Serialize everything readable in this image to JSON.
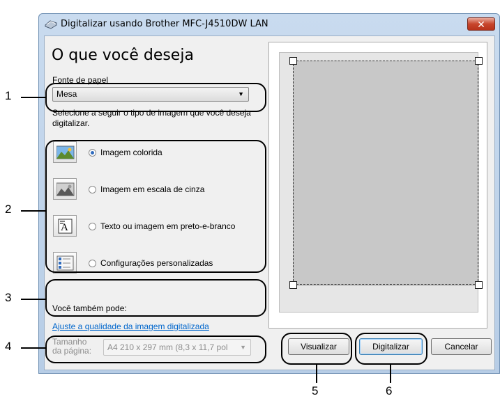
{
  "window": {
    "title": "Digitalizar usando Brother MFC-J4510DW LAN",
    "close_label": "✕"
  },
  "main": {
    "heading": "O que você deseja",
    "paper_source_label": "Fonte de papel",
    "paper_source_value": "Mesa",
    "instruction": "Selecione a seguir o tipo de imagem que você deseja digitalizar.",
    "image_types": [
      {
        "label": "Imagem colorida",
        "selected": true,
        "icon": "color-photo-icon"
      },
      {
        "label": "Imagem em escala de cinza",
        "selected": false,
        "icon": "grayscale-photo-icon"
      },
      {
        "label": "Texto ou imagem em preto-e-branco",
        "selected": false,
        "icon": "bw-text-icon"
      },
      {
        "label": "Configurações personalizadas",
        "selected": false,
        "icon": "custom-settings-icon"
      }
    ],
    "also_label": "Você também pode:",
    "adjust_link": "Ajuste a qualidade da imagem digitalizada",
    "page_size_label_line1": "Tamanho",
    "page_size_label_line2": "da página:",
    "page_size_value": "A4 210 x 297 mm (8,3 x 11,7 pol"
  },
  "buttons": {
    "preview": "Visualizar",
    "scan": "Digitalizar",
    "cancel": "Cancelar"
  },
  "callouts": [
    "1",
    "2",
    "3",
    "4",
    "5",
    "6"
  ]
}
